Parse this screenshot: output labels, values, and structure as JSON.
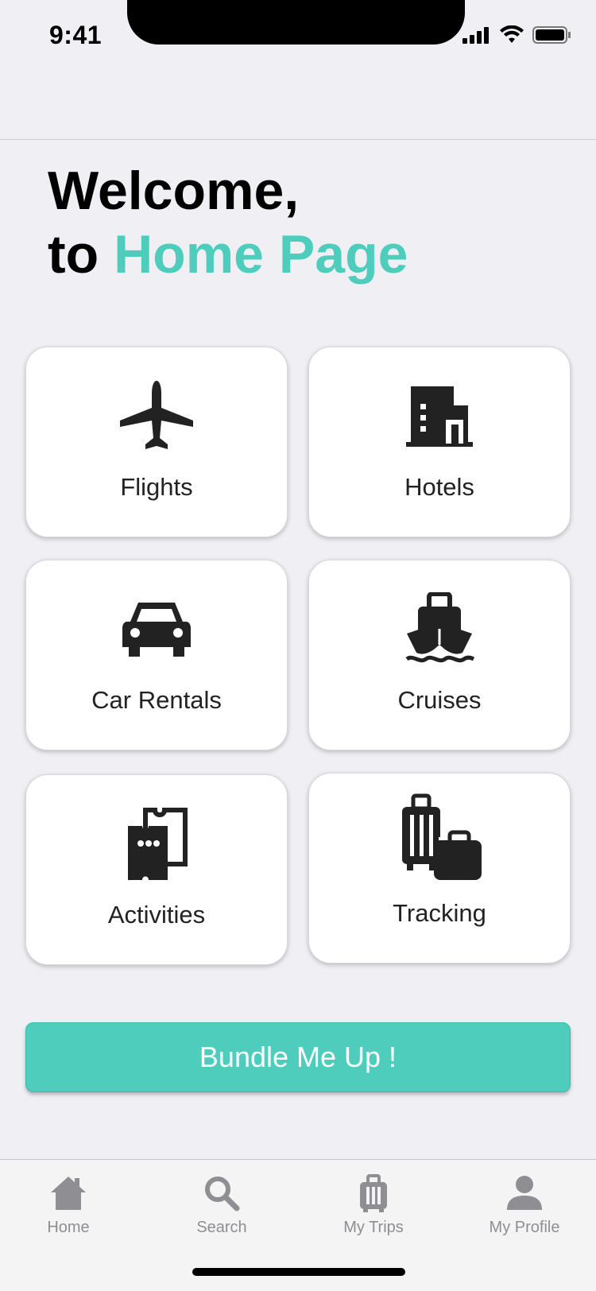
{
  "status_bar": {
    "time": "9:41"
  },
  "welcome": {
    "line1": "Welcome,",
    "line2_prefix": "to ",
    "line2_accent": "Home Page"
  },
  "tiles": [
    {
      "label": "Flights",
      "icon": "airplane-icon"
    },
    {
      "label": "Hotels",
      "icon": "building-icon"
    },
    {
      "label": "Car Rentals",
      "icon": "car-icon"
    },
    {
      "label": "Cruises",
      "icon": "ship-icon"
    },
    {
      "label": "Activities",
      "icon": "ticket-icon"
    },
    {
      "label": "Tracking",
      "icon": "luggage-icon"
    }
  ],
  "bundle_button": {
    "label": "Bundle Me Up !"
  },
  "tab_bar": {
    "tabs": [
      {
        "label": "Home",
        "icon": "home-icon"
      },
      {
        "label": "Search",
        "icon": "search-icon"
      },
      {
        "label": "My Trips",
        "icon": "suitcase-icon"
      },
      {
        "label": "My Profile",
        "icon": "user-icon"
      }
    ]
  },
  "colors": {
    "accent": "#4ecdbd",
    "background": "#efeff4",
    "icon": "#222222",
    "tab_inactive": "#8e8e93"
  }
}
